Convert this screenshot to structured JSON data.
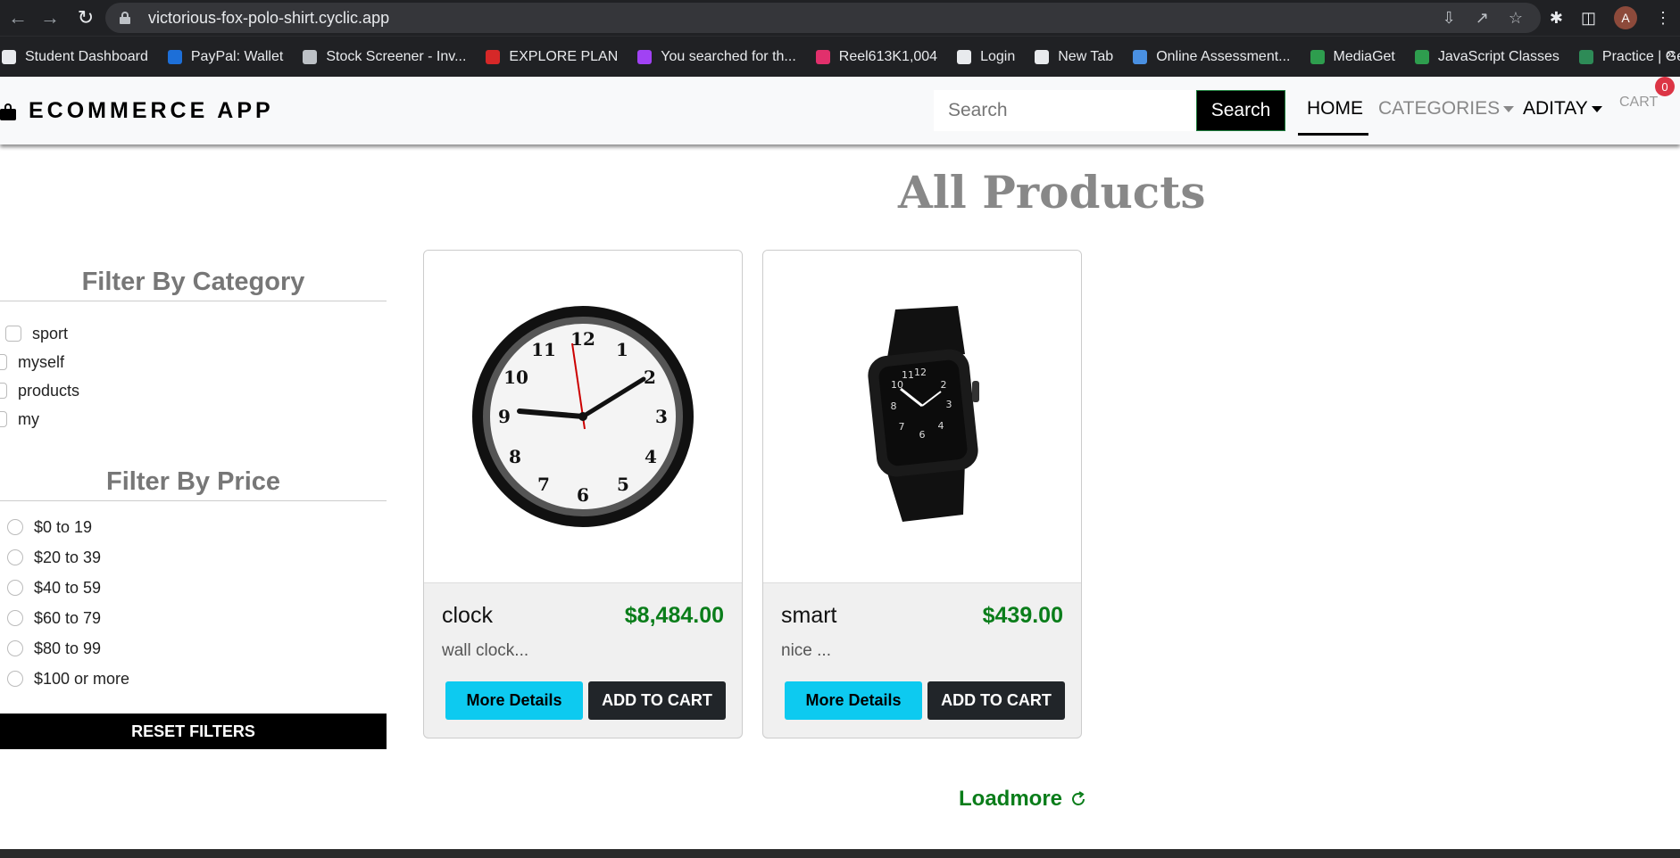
{
  "browser": {
    "url": "victorious-fox-polo-shirt.cyclic.app",
    "avatar_letter": "A",
    "bookmarks": [
      {
        "label": "Student Dashboard",
        "color": "#e8eaed"
      },
      {
        "label": "PayPal: Wallet",
        "color": "#1d6fd8"
      },
      {
        "label": "Stock Screener - Inv...",
        "color": "#bdc1c6"
      },
      {
        "label": "EXPLORE PLAN",
        "color": "#d62828"
      },
      {
        "label": "You searched for th...",
        "color": "#a142f4"
      },
      {
        "label": "Reel613K1,004",
        "color": "#e1306c"
      },
      {
        "label": "Login",
        "color": "#e8eaed"
      },
      {
        "label": "New Tab",
        "color": "#e8eaed"
      },
      {
        "label": "Online Assessment...",
        "color": "#4a90e2"
      },
      {
        "label": "MediaGet",
        "color": "#2e9d4e"
      },
      {
        "label": "JavaScript Classes",
        "color": "#2e9d4e"
      },
      {
        "label": "Practice | Geeksfor...",
        "color": "#2e8b57"
      }
    ],
    "bookmarks_more": "»"
  },
  "header": {
    "brand": "ECOMMERCE APP",
    "search_placeholder": "Search",
    "search_button": "Search",
    "nav_home": "HOME",
    "nav_categories": "CATEGORIES",
    "nav_user": "ADITAY",
    "nav_cart": "CART",
    "cart_count": "0"
  },
  "main": {
    "title": "All Products",
    "filters": {
      "category_heading": "Filter By Category",
      "categories": [
        "sport",
        "myself",
        "products",
        "my"
      ],
      "price_heading": "Filter By Price",
      "prices": [
        "$0 to 19",
        "$20 to 39",
        "$40 to 59",
        "$60 to 79",
        "$80 to 99",
        "$100 or more"
      ],
      "reset_label": "RESET FILTERS"
    },
    "products": [
      {
        "name": "clock",
        "price": "$8,484.00",
        "description": "wall clock...",
        "details_label": "More Details",
        "cart_label": "ADD TO CART"
      },
      {
        "name": "smart",
        "price": "$439.00",
        "description": "nice ...",
        "details_label": "More Details",
        "cart_label": "ADD TO CART"
      }
    ],
    "loadmore": "Loadmore"
  },
  "colors": {
    "accent_green": "#0a7d1a",
    "details_button": "#0dcaf0",
    "cart_badge": "#dc3545"
  }
}
